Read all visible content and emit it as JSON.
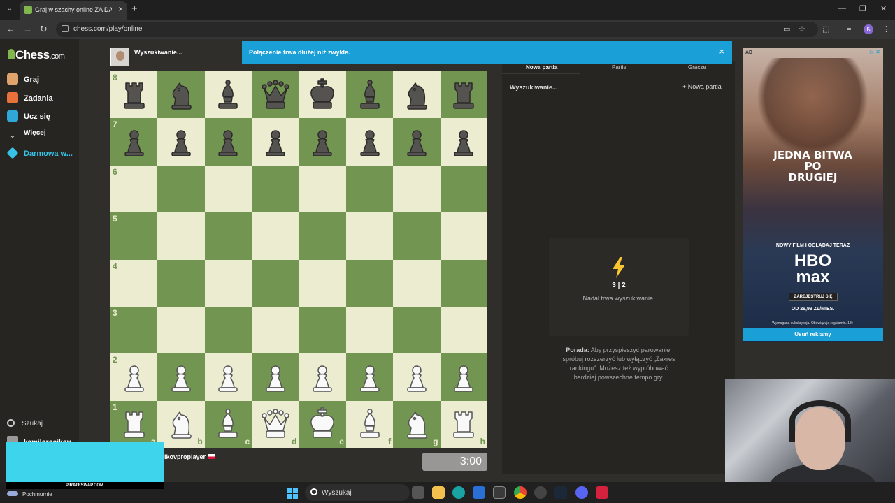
{
  "browser": {
    "tab_title": "Graj w szachy online ZA DARMO",
    "url": "chess.com/play/online",
    "profile_initial": "K"
  },
  "sidebar": {
    "logo_text": "Chess",
    "logo_suffix": ".com",
    "items": [
      {
        "label": "Graj",
        "icon": "play-icon",
        "color": "#e0a36b"
      },
      {
        "label": "Zadania",
        "icon": "puzzle-icon",
        "color": "#e8713c"
      },
      {
        "label": "Ucz się",
        "icon": "learn-icon",
        "color": "#2fa7d8"
      },
      {
        "label": "Więcej",
        "icon": "chevron-down-icon",
        "color": "#ccc"
      },
      {
        "label": "Darmowa w...",
        "icon": "diamond-icon",
        "color": "#36c3e6"
      }
    ],
    "search_label": "Szukaj",
    "username": "kamilorosikov"
  },
  "game": {
    "top_player": "Wyszukiwanie...",
    "bottom_player": "ikovproplayer",
    "clock": "3:00",
    "ranks": [
      "8",
      "7",
      "6",
      "5",
      "4",
      "3",
      "2",
      "1"
    ],
    "files": [
      "a",
      "b",
      "c",
      "d",
      "e",
      "f",
      "g",
      "h"
    ],
    "position": [
      [
        "r",
        "n",
        "b",
        "q",
        "k",
        "b",
        "n",
        "r"
      ],
      [
        "p",
        "p",
        "p",
        "p",
        "p",
        "p",
        "p",
        "p"
      ],
      [
        "",
        "",
        "",
        "",
        "",
        "",
        "",
        ""
      ],
      [
        "",
        "",
        "",
        "",
        "",
        "",
        "",
        ""
      ],
      [
        "",
        "",
        "",
        "",
        "",
        "",
        "",
        ""
      ],
      [
        "",
        "",
        "",
        "",
        "",
        "",
        "",
        ""
      ],
      [
        "P",
        "P",
        "P",
        "P",
        "P",
        "P",
        "P",
        "P"
      ],
      [
        "R",
        "N",
        "B",
        "Q",
        "K",
        "B",
        "N",
        "R"
      ]
    ],
    "colors": {
      "light": "#ebecd0",
      "dark": "#739552"
    }
  },
  "banner": {
    "text": "Połączenie trwa dłużej niż zwykle.",
    "close": "×",
    "color": "#1a9fd6"
  },
  "panel": {
    "tabs": [
      "Nowa partia",
      "Partie",
      "Gracze"
    ],
    "status": "Wyszukiwanie...",
    "new_game": "+ Nowa partia",
    "time_control": "3 | 2",
    "searching_text": "Nadal trwa wyszukiwanie.",
    "tip_label": "Porada:",
    "tip_text": "Aby przyspieszyć parowanie, spróbuj rozszerzyć lub wyłączyć „Zakres rankingu”. Możesz też wypróbować bardziej powszechne tempo gry."
  },
  "ad": {
    "label": "AD",
    "headline_lines": [
      "JEDNA BITWA",
      "PO",
      "DRUGIEJ"
    ],
    "subline": "NOWY FILM I OGLĄDAJ TERAZ",
    "brand_lines": [
      "HBO",
      "max"
    ],
    "cta": "ZAREJESTRUJ SIĘ",
    "price": "OD 29,99 ZŁ/MIES.",
    "fine_print": "Wymagana subskrypcja. Obowiązują regulamin. 18+",
    "remove": "Usuń reklamy"
  },
  "overlay": {
    "caption": "PIRATESWAP.COM"
  },
  "taskbar": {
    "weather": "Pochmurnie",
    "search_placeholder": "Wyszukaj"
  }
}
